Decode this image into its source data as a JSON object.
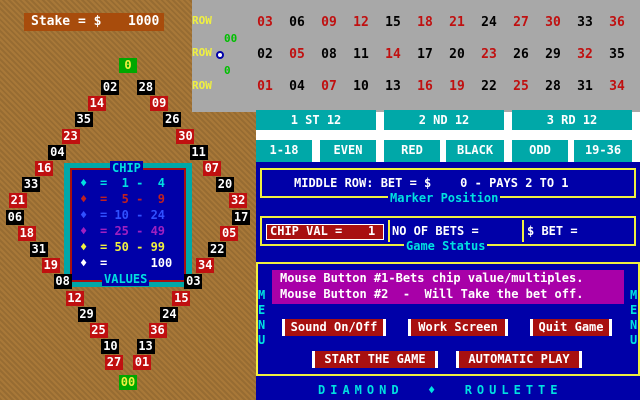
{
  "stake": {
    "label": "Stake = $",
    "value": "1000"
  },
  "row_labels": [
    "ROW",
    "ROW",
    "ROW"
  ],
  "side_zeros": [
    "00",
    "0"
  ],
  "grid_rows": [
    [
      {
        "n": "03",
        "c": "red"
      },
      {
        "n": "06",
        "c": "black"
      },
      {
        "n": "09",
        "c": "red"
      },
      {
        "n": "12",
        "c": "red"
      },
      {
        "n": "15",
        "c": "black"
      },
      {
        "n": "18",
        "c": "red"
      },
      {
        "n": "21",
        "c": "red"
      },
      {
        "n": "24",
        "c": "black"
      },
      {
        "n": "27",
        "c": "red"
      },
      {
        "n": "30",
        "c": "red"
      },
      {
        "n": "33",
        "c": "black"
      },
      {
        "n": "36",
        "c": "red"
      }
    ],
    [
      {
        "n": "02",
        "c": "black"
      },
      {
        "n": "05",
        "c": "red"
      },
      {
        "n": "08",
        "c": "black"
      },
      {
        "n": "11",
        "c": "black"
      },
      {
        "n": "14",
        "c": "red"
      },
      {
        "n": "17",
        "c": "black"
      },
      {
        "n": "20",
        "c": "black"
      },
      {
        "n": "23",
        "c": "red"
      },
      {
        "n": "26",
        "c": "black"
      },
      {
        "n": "29",
        "c": "black"
      },
      {
        "n": "32",
        "c": "red"
      },
      {
        "n": "35",
        "c": "black"
      }
    ],
    [
      {
        "n": "01",
        "c": "red"
      },
      {
        "n": "04",
        "c": "black"
      },
      {
        "n": "07",
        "c": "red"
      },
      {
        "n": "10",
        "c": "black"
      },
      {
        "n": "13",
        "c": "black"
      },
      {
        "n": "16",
        "c": "red"
      },
      {
        "n": "19",
        "c": "red"
      },
      {
        "n": "22",
        "c": "black"
      },
      {
        "n": "25",
        "c": "red"
      },
      {
        "n": "28",
        "c": "black"
      },
      {
        "n": "31",
        "c": "black"
      },
      {
        "n": "34",
        "c": "red"
      }
    ]
  ],
  "dozens": [
    "1 ST 12",
    "2 ND 12",
    "3 RD 12"
  ],
  "even_bets": [
    "1-18",
    "EVEN",
    "RED",
    "BLACK",
    "ODD",
    "19-36"
  ],
  "diamond": {
    "top_zero": "0",
    "bottom_zero": "00",
    "left": [
      "02",
      "14",
      "35",
      "23",
      "04",
      "16",
      "33",
      "21",
      "06",
      "18",
      "31",
      "19",
      "08",
      "12",
      "29",
      "25",
      "10",
      "27"
    ],
    "right": [
      "28",
      "09",
      "26",
      "30",
      "11",
      "07",
      "20",
      "32",
      "17",
      "05",
      "22",
      "34",
      "03",
      "15",
      "24",
      "36",
      "13",
      "01"
    ],
    "left_colors": [
      "black",
      "red",
      "black",
      "red",
      "black",
      "red",
      "black",
      "red",
      "black",
      "red",
      "black",
      "red",
      "black",
      "red",
      "black",
      "red",
      "black",
      "red"
    ],
    "right_colors": [
      "black",
      "red",
      "black",
      "red",
      "black",
      "red",
      "black",
      "red",
      "black",
      "red",
      "black",
      "red",
      "black",
      "red",
      "black",
      "red",
      "black",
      "red"
    ]
  },
  "chip_panel": {
    "title": "CHIP",
    "footer": "VALUES",
    "rows": [
      {
        "text": "=  1 -  4",
        "color": "#00e0e0"
      },
      {
        "text": "=  5 -  9",
        "color": "#c02020"
      },
      {
        "text": "= 10 - 24",
        "color": "#3050ff"
      },
      {
        "text": "= 25 - 49",
        "color": "#a020c0"
      },
      {
        "text": "= 50 - 99",
        "color": "#f0f040"
      },
      {
        "text": "=      100",
        "color": "#ffffff"
      }
    ]
  },
  "bet_line": "MIDDLE ROW: BET = $    0 - PAYS 2 TO 1",
  "marker_position": "Marker Position",
  "chip_val": {
    "label": "CHIP VAL =",
    "value": "1"
  },
  "no_of_bets": "NO OF BETS =",
  "dollar_bet": "$ BET =",
  "game_status": "Game Status",
  "help_lines": [
    "Mouse Button #1-Bets chip value/multiples.",
    "Mouse Button #2  -  Will Take the bet off."
  ],
  "menu_letters": [
    "M",
    "E",
    "N",
    "U"
  ],
  "buttons": {
    "sound": "Sound On/Off",
    "work_screen": "Work Screen",
    "quit": "Quit Game",
    "start": "START THE GAME",
    "auto": "AUTOMATIC PLAY"
  },
  "footer_title": "DIAMOND  ♦  ROULETTE",
  "colors": {
    "red": "#c01010",
    "black": "#000000",
    "teal": "#00a8a8",
    "blue": "#0000a8",
    "brown": "#a87838"
  }
}
